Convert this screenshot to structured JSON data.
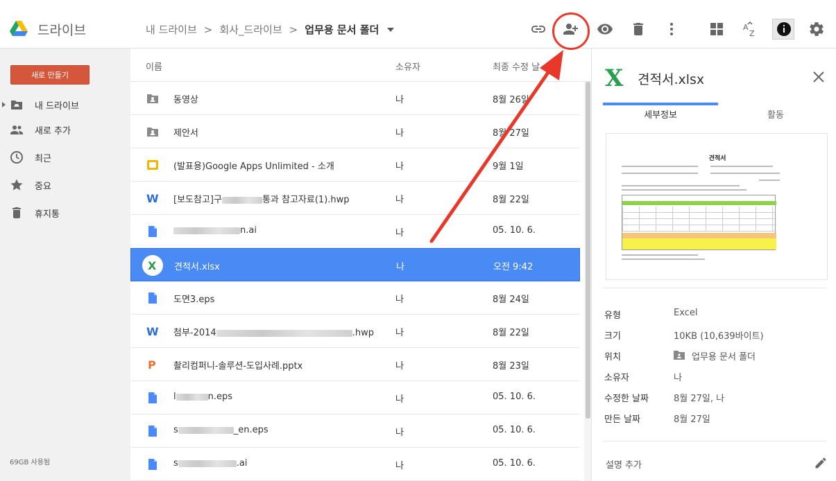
{
  "app": {
    "title": "드라이브"
  },
  "breadcrumb": {
    "items": [
      "내 드라이브",
      "회사_드라이브"
    ],
    "current": "업무용 문서 폴더"
  },
  "toolbar": {
    "icons": [
      "link-icon",
      "share-person-add-icon",
      "eye-icon",
      "trash-icon",
      "more-vert-icon",
      "grid-view-icon",
      "sort-az-icon",
      "info-icon",
      "settings-gear-icon"
    ]
  },
  "sidebar": {
    "new_button": "새로 만들기",
    "items": [
      {
        "label": "내 드라이브",
        "icon": "drive-folder-icon"
      },
      {
        "label": "새로 추가",
        "icon": "people-icon"
      },
      {
        "label": "최근",
        "icon": "clock-icon"
      },
      {
        "label": "중요",
        "icon": "star-icon"
      },
      {
        "label": "휴지통",
        "icon": "trash-icon"
      }
    ],
    "storage": "69GB 사용됨"
  },
  "list": {
    "headers": {
      "name": "이름",
      "owner": "소유자",
      "modified": "최종 수정 날"
    },
    "rows": [
      {
        "name": "동영상",
        "owner": "나",
        "modified": "8월 26일",
        "type": "shared-folder"
      },
      {
        "name": "제안서",
        "owner": "나",
        "modified": "8월 27일",
        "type": "shared-folder"
      },
      {
        "name": "(발표용)Google Apps Unlimited - 소개",
        "owner": "나",
        "modified": "9월 1일",
        "type": "slides"
      },
      {
        "name_pre": "[보도참고]구",
        "name_post": "통과 참고자료(1).hwp",
        "owner": "나",
        "modified": "8월 22일",
        "type": "word"
      },
      {
        "name_pre": "",
        "name_post": "n.ai",
        "owner": "나",
        "modified": "05. 10. 6.",
        "type": "doc"
      },
      {
        "name": "견적서.xlsx",
        "owner": "나",
        "modified": "오전 9:42",
        "type": "excel",
        "selected": true
      },
      {
        "name": "도면3.eps",
        "owner": "나",
        "modified": "8월 24일",
        "type": "doc"
      },
      {
        "name_pre": "첨부-2014",
        "name_post": ".hwp",
        "owner": "나",
        "modified": "8월 22일",
        "type": "word"
      },
      {
        "name": "촬리컴퍼니-솔루션-도입사례.pptx",
        "owner": "나",
        "modified": "8월 23일",
        "type": "powerpoint"
      },
      {
        "name_pre": "l",
        "name_post": "n.eps",
        "owner": "나",
        "modified": "05. 10. 6.",
        "type": "doc"
      },
      {
        "name_pre": "s",
        "name_post": "_en.eps",
        "owner": "나",
        "modified": "05. 10. 6.",
        "type": "doc"
      },
      {
        "name_pre": "s",
        "name_post": ".ai",
        "owner": "나",
        "modified": "05. 10. 6.",
        "type": "doc"
      }
    ]
  },
  "details": {
    "title": "견적서.xlsx",
    "tabs": [
      "세부정보",
      "활동"
    ],
    "preview": {
      "title": "견적서"
    },
    "props": [
      {
        "key": "유형",
        "value": "Excel"
      },
      {
        "key": "크기",
        "value": "10KB (10,639바이트)"
      },
      {
        "key": "위치",
        "value": "업무용 문서 폴더"
      },
      {
        "key": "소유자",
        "value": "나"
      },
      {
        "key": "수정한 날짜",
        "value": "8월 27일, 나"
      },
      {
        "key": "만든 날짜",
        "value": "8월 27일"
      }
    ],
    "add_description": "설명 추가"
  },
  "colors": {
    "accent": "#4a8af4",
    "new_button": "#d5573b",
    "annotation": "#e8382a",
    "excel": "#2a9d50"
  }
}
